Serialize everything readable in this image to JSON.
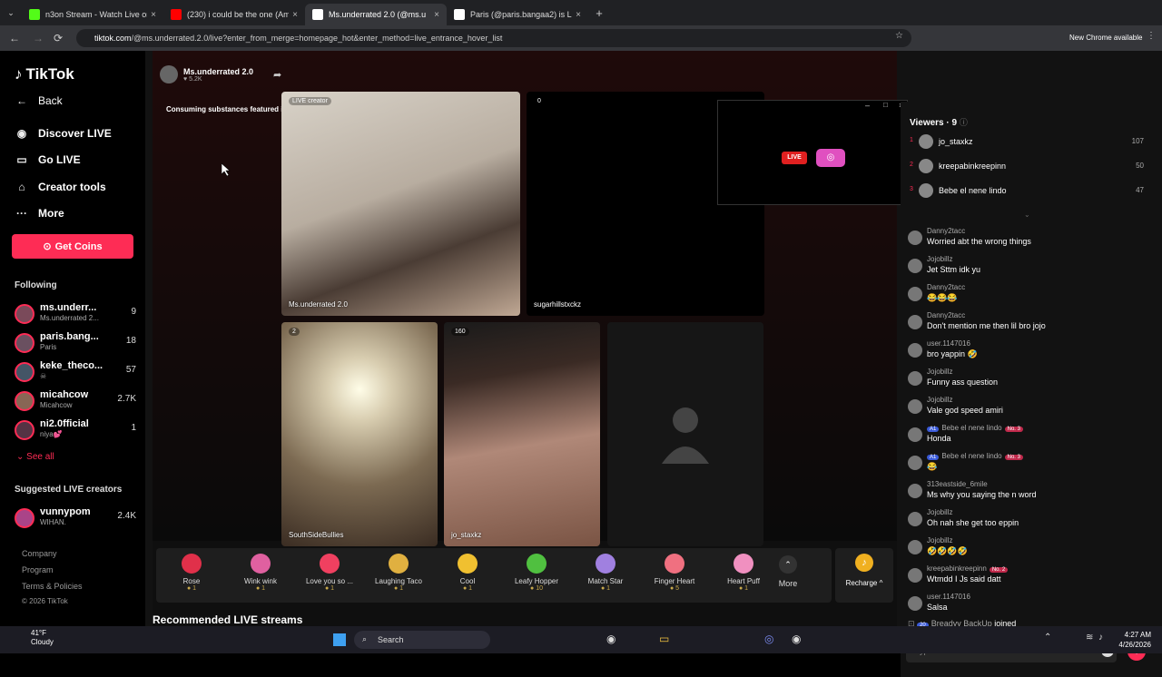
{
  "tabs": [
    {
      "title": "n3on Stream - Watch Live on K",
      "fav_color": "#53fc18",
      "active": false
    },
    {
      "title": "(230) i could be the one (Amb",
      "fav_color": "#ff0000",
      "active": false
    },
    {
      "title": "Ms.underrated 2.0 (@ms.u",
      "fav_color": "#ffffff",
      "active": true
    },
    {
      "title": "Paris (@paris.bangaa2) is L",
      "fav_color": "#ffffff",
      "active": false
    }
  ],
  "url": {
    "domain": "tiktok.com",
    "path": "/@ms.underrated.2.0/live?enter_from_merge=homepage_hot&enter_method=live_entrance_hover_list"
  },
  "chrome_update": "New Chrome available",
  "sidebar": {
    "logo": "TikTok",
    "back": "Back",
    "nav": [
      "Discover LIVE",
      "Go LIVE",
      "Creator tools",
      "More"
    ],
    "get_coins": "Get Coins",
    "following_title": "Following",
    "following": [
      {
        "name": "ms.underr...",
        "sub": "Ms.underrated 2...",
        "count": "9",
        "color": "#7a4a5a"
      },
      {
        "name": "paris.bang...",
        "sub": "Paris",
        "count": "18",
        "color": "#6a5060"
      },
      {
        "name": "keke_theco...",
        "sub": "☠",
        "count": "57",
        "color": "#445566"
      },
      {
        "name": "micahcow",
        "sub": "Micahcow",
        "count": "2.7K",
        "color": "#886655"
      },
      {
        "name": "ni2.0fficial",
        "sub": "niya💕",
        "count": "1",
        "color": "#553344"
      }
    ],
    "see_all": "See all",
    "suggested_title": "Suggested LIVE creators",
    "suggested": [
      {
        "name": "vunnypom",
        "sub": "WIHAN.",
        "count": "2.4K",
        "color": "#aa4488"
      }
    ],
    "footer": [
      "Company",
      "Program",
      "Terms & Policies",
      "© 2026 TikTok"
    ]
  },
  "stage": {
    "host_name": "Ms.underrated 2.0",
    "host_likes": "♥ 5.2K",
    "warning": "Consuming substances featured in this LIVE could ha...",
    "main_tile": {
      "badge": "LIVE creator",
      "label": "Ms.underrated 2.0"
    },
    "tiles": [
      {
        "label": "sugarhillstxckz",
        "count": "0"
      },
      {
        "label": "SouthSideBullies",
        "count": "2"
      },
      {
        "label": "jo_staxkz",
        "count": "160"
      }
    ],
    "recommended": "Recommended LIVE streams"
  },
  "gifts": [
    {
      "name": "Rose",
      "price": "1",
      "color": "#e0304a"
    },
    {
      "name": "Wink wink",
      "price": "1",
      "color": "#e060a0"
    },
    {
      "name": "Love you so ...",
      "price": "1",
      "color": "#f04060"
    },
    {
      "name": "Laughing Taco",
      "price": "1",
      "color": "#e0b040"
    },
    {
      "name": "Cool",
      "price": "1",
      "color": "#f0c030"
    },
    {
      "name": "Leafy Hopper",
      "price": "10",
      "color": "#50c040"
    },
    {
      "name": "Match Star",
      "price": "1",
      "color": "#a080e0"
    },
    {
      "name": "Finger Heart",
      "price": "5",
      "color": "#f07080"
    },
    {
      "name": "Heart Puff",
      "price": "1",
      "color": "#f090c0"
    }
  ],
  "more_label": "More",
  "recharge_label": "Recharge ^",
  "viewers": {
    "title": "Viewers · 9",
    "list": [
      {
        "rank": "1",
        "name": "jo_staxkz",
        "score": "107"
      },
      {
        "rank": "2",
        "name": "kreepabinkreepinn",
        "score": "50"
      },
      {
        "rank": "3",
        "name": "Bebe el nene lindo",
        "score": "47"
      }
    ]
  },
  "chat": [
    {
      "user": "Danny2tacc",
      "text": "Worried abt the wrong things"
    },
    {
      "user": "Jojobillz",
      "text": "Jet Sttm idk yu"
    },
    {
      "user": "Danny2tacc",
      "text": "😂😂😂"
    },
    {
      "user": "Danny2tacc",
      "text": "Don't mention me then lil bro jojo"
    },
    {
      "user": "user.1147016",
      "text": "bro yappin 🤣"
    },
    {
      "user": "Jojobillz",
      "text": "Funny ass question"
    },
    {
      "user": "Jojobillz",
      "text": "Vale god speed amiri"
    },
    {
      "user": "Bebe el nene lindo",
      "text": "Honda",
      "lvl": "A1",
      "badge": "No. 3"
    },
    {
      "user": "Bebe el nene lindo",
      "text": "😂",
      "lvl": "A1",
      "badge": "No. 3"
    },
    {
      "user": "313eastside_6mile",
      "text": "Ms why you saying the n word"
    },
    {
      "user": "Jojobillz",
      "text": "Oh nah she get too eppin"
    },
    {
      "user": "Jojobillz",
      "text": "🤣🤣🤣🤣"
    },
    {
      "user": "kreepabinkreepinn",
      "text": "Wtmdd I Js said datt",
      "badge": "No. 2"
    },
    {
      "user": "user.1147016",
      "text": "Salsa"
    }
  ],
  "joined": {
    "level": "20",
    "user": "Breadyy BackUp",
    "text": "joined"
  },
  "type_placeholder": "Type...",
  "taskbar": {
    "weather": "41°F",
    "weather_sub": "Cloudy",
    "search": "Search",
    "time": "4:27 AM",
    "date": "4/26/2026"
  }
}
